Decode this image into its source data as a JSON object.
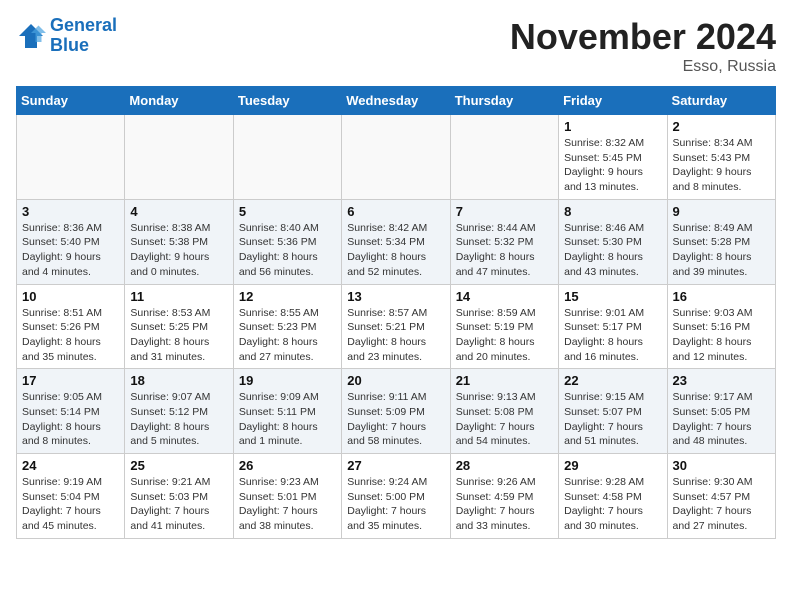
{
  "header": {
    "logo_line1": "General",
    "logo_line2": "Blue",
    "month": "November 2024",
    "location": "Esso, Russia"
  },
  "weekdays": [
    "Sunday",
    "Monday",
    "Tuesday",
    "Wednesday",
    "Thursday",
    "Friday",
    "Saturday"
  ],
  "weeks": [
    [
      {
        "day": "",
        "info": ""
      },
      {
        "day": "",
        "info": ""
      },
      {
        "day": "",
        "info": ""
      },
      {
        "day": "",
        "info": ""
      },
      {
        "day": "",
        "info": ""
      },
      {
        "day": "1",
        "info": "Sunrise: 8:32 AM\nSunset: 5:45 PM\nDaylight: 9 hours and 13 minutes."
      },
      {
        "day": "2",
        "info": "Sunrise: 8:34 AM\nSunset: 5:43 PM\nDaylight: 9 hours and 8 minutes."
      }
    ],
    [
      {
        "day": "3",
        "info": "Sunrise: 8:36 AM\nSunset: 5:40 PM\nDaylight: 9 hours and 4 minutes."
      },
      {
        "day": "4",
        "info": "Sunrise: 8:38 AM\nSunset: 5:38 PM\nDaylight: 9 hours and 0 minutes."
      },
      {
        "day": "5",
        "info": "Sunrise: 8:40 AM\nSunset: 5:36 PM\nDaylight: 8 hours and 56 minutes."
      },
      {
        "day": "6",
        "info": "Sunrise: 8:42 AM\nSunset: 5:34 PM\nDaylight: 8 hours and 52 minutes."
      },
      {
        "day": "7",
        "info": "Sunrise: 8:44 AM\nSunset: 5:32 PM\nDaylight: 8 hours and 47 minutes."
      },
      {
        "day": "8",
        "info": "Sunrise: 8:46 AM\nSunset: 5:30 PM\nDaylight: 8 hours and 43 minutes."
      },
      {
        "day": "9",
        "info": "Sunrise: 8:49 AM\nSunset: 5:28 PM\nDaylight: 8 hours and 39 minutes."
      }
    ],
    [
      {
        "day": "10",
        "info": "Sunrise: 8:51 AM\nSunset: 5:26 PM\nDaylight: 8 hours and 35 minutes."
      },
      {
        "day": "11",
        "info": "Sunrise: 8:53 AM\nSunset: 5:25 PM\nDaylight: 8 hours and 31 minutes."
      },
      {
        "day": "12",
        "info": "Sunrise: 8:55 AM\nSunset: 5:23 PM\nDaylight: 8 hours and 27 minutes."
      },
      {
        "day": "13",
        "info": "Sunrise: 8:57 AM\nSunset: 5:21 PM\nDaylight: 8 hours and 23 minutes."
      },
      {
        "day": "14",
        "info": "Sunrise: 8:59 AM\nSunset: 5:19 PM\nDaylight: 8 hours and 20 minutes."
      },
      {
        "day": "15",
        "info": "Sunrise: 9:01 AM\nSunset: 5:17 PM\nDaylight: 8 hours and 16 minutes."
      },
      {
        "day": "16",
        "info": "Sunrise: 9:03 AM\nSunset: 5:16 PM\nDaylight: 8 hours and 12 minutes."
      }
    ],
    [
      {
        "day": "17",
        "info": "Sunrise: 9:05 AM\nSunset: 5:14 PM\nDaylight: 8 hours and 8 minutes."
      },
      {
        "day": "18",
        "info": "Sunrise: 9:07 AM\nSunset: 5:12 PM\nDaylight: 8 hours and 5 minutes."
      },
      {
        "day": "19",
        "info": "Sunrise: 9:09 AM\nSunset: 5:11 PM\nDaylight: 8 hours and 1 minute."
      },
      {
        "day": "20",
        "info": "Sunrise: 9:11 AM\nSunset: 5:09 PM\nDaylight: 7 hours and 58 minutes."
      },
      {
        "day": "21",
        "info": "Sunrise: 9:13 AM\nSunset: 5:08 PM\nDaylight: 7 hours and 54 minutes."
      },
      {
        "day": "22",
        "info": "Sunrise: 9:15 AM\nSunset: 5:07 PM\nDaylight: 7 hours and 51 minutes."
      },
      {
        "day": "23",
        "info": "Sunrise: 9:17 AM\nSunset: 5:05 PM\nDaylight: 7 hours and 48 minutes."
      }
    ],
    [
      {
        "day": "24",
        "info": "Sunrise: 9:19 AM\nSunset: 5:04 PM\nDaylight: 7 hours and 45 minutes."
      },
      {
        "day": "25",
        "info": "Sunrise: 9:21 AM\nSunset: 5:03 PM\nDaylight: 7 hours and 41 minutes."
      },
      {
        "day": "26",
        "info": "Sunrise: 9:23 AM\nSunset: 5:01 PM\nDaylight: 7 hours and 38 minutes."
      },
      {
        "day": "27",
        "info": "Sunrise: 9:24 AM\nSunset: 5:00 PM\nDaylight: 7 hours and 35 minutes."
      },
      {
        "day": "28",
        "info": "Sunrise: 9:26 AM\nSunset: 4:59 PM\nDaylight: 7 hours and 33 minutes."
      },
      {
        "day": "29",
        "info": "Sunrise: 9:28 AM\nSunset: 4:58 PM\nDaylight: 7 hours and 30 minutes."
      },
      {
        "day": "30",
        "info": "Sunrise: 9:30 AM\nSunset: 4:57 PM\nDaylight: 7 hours and 27 minutes."
      }
    ]
  ]
}
